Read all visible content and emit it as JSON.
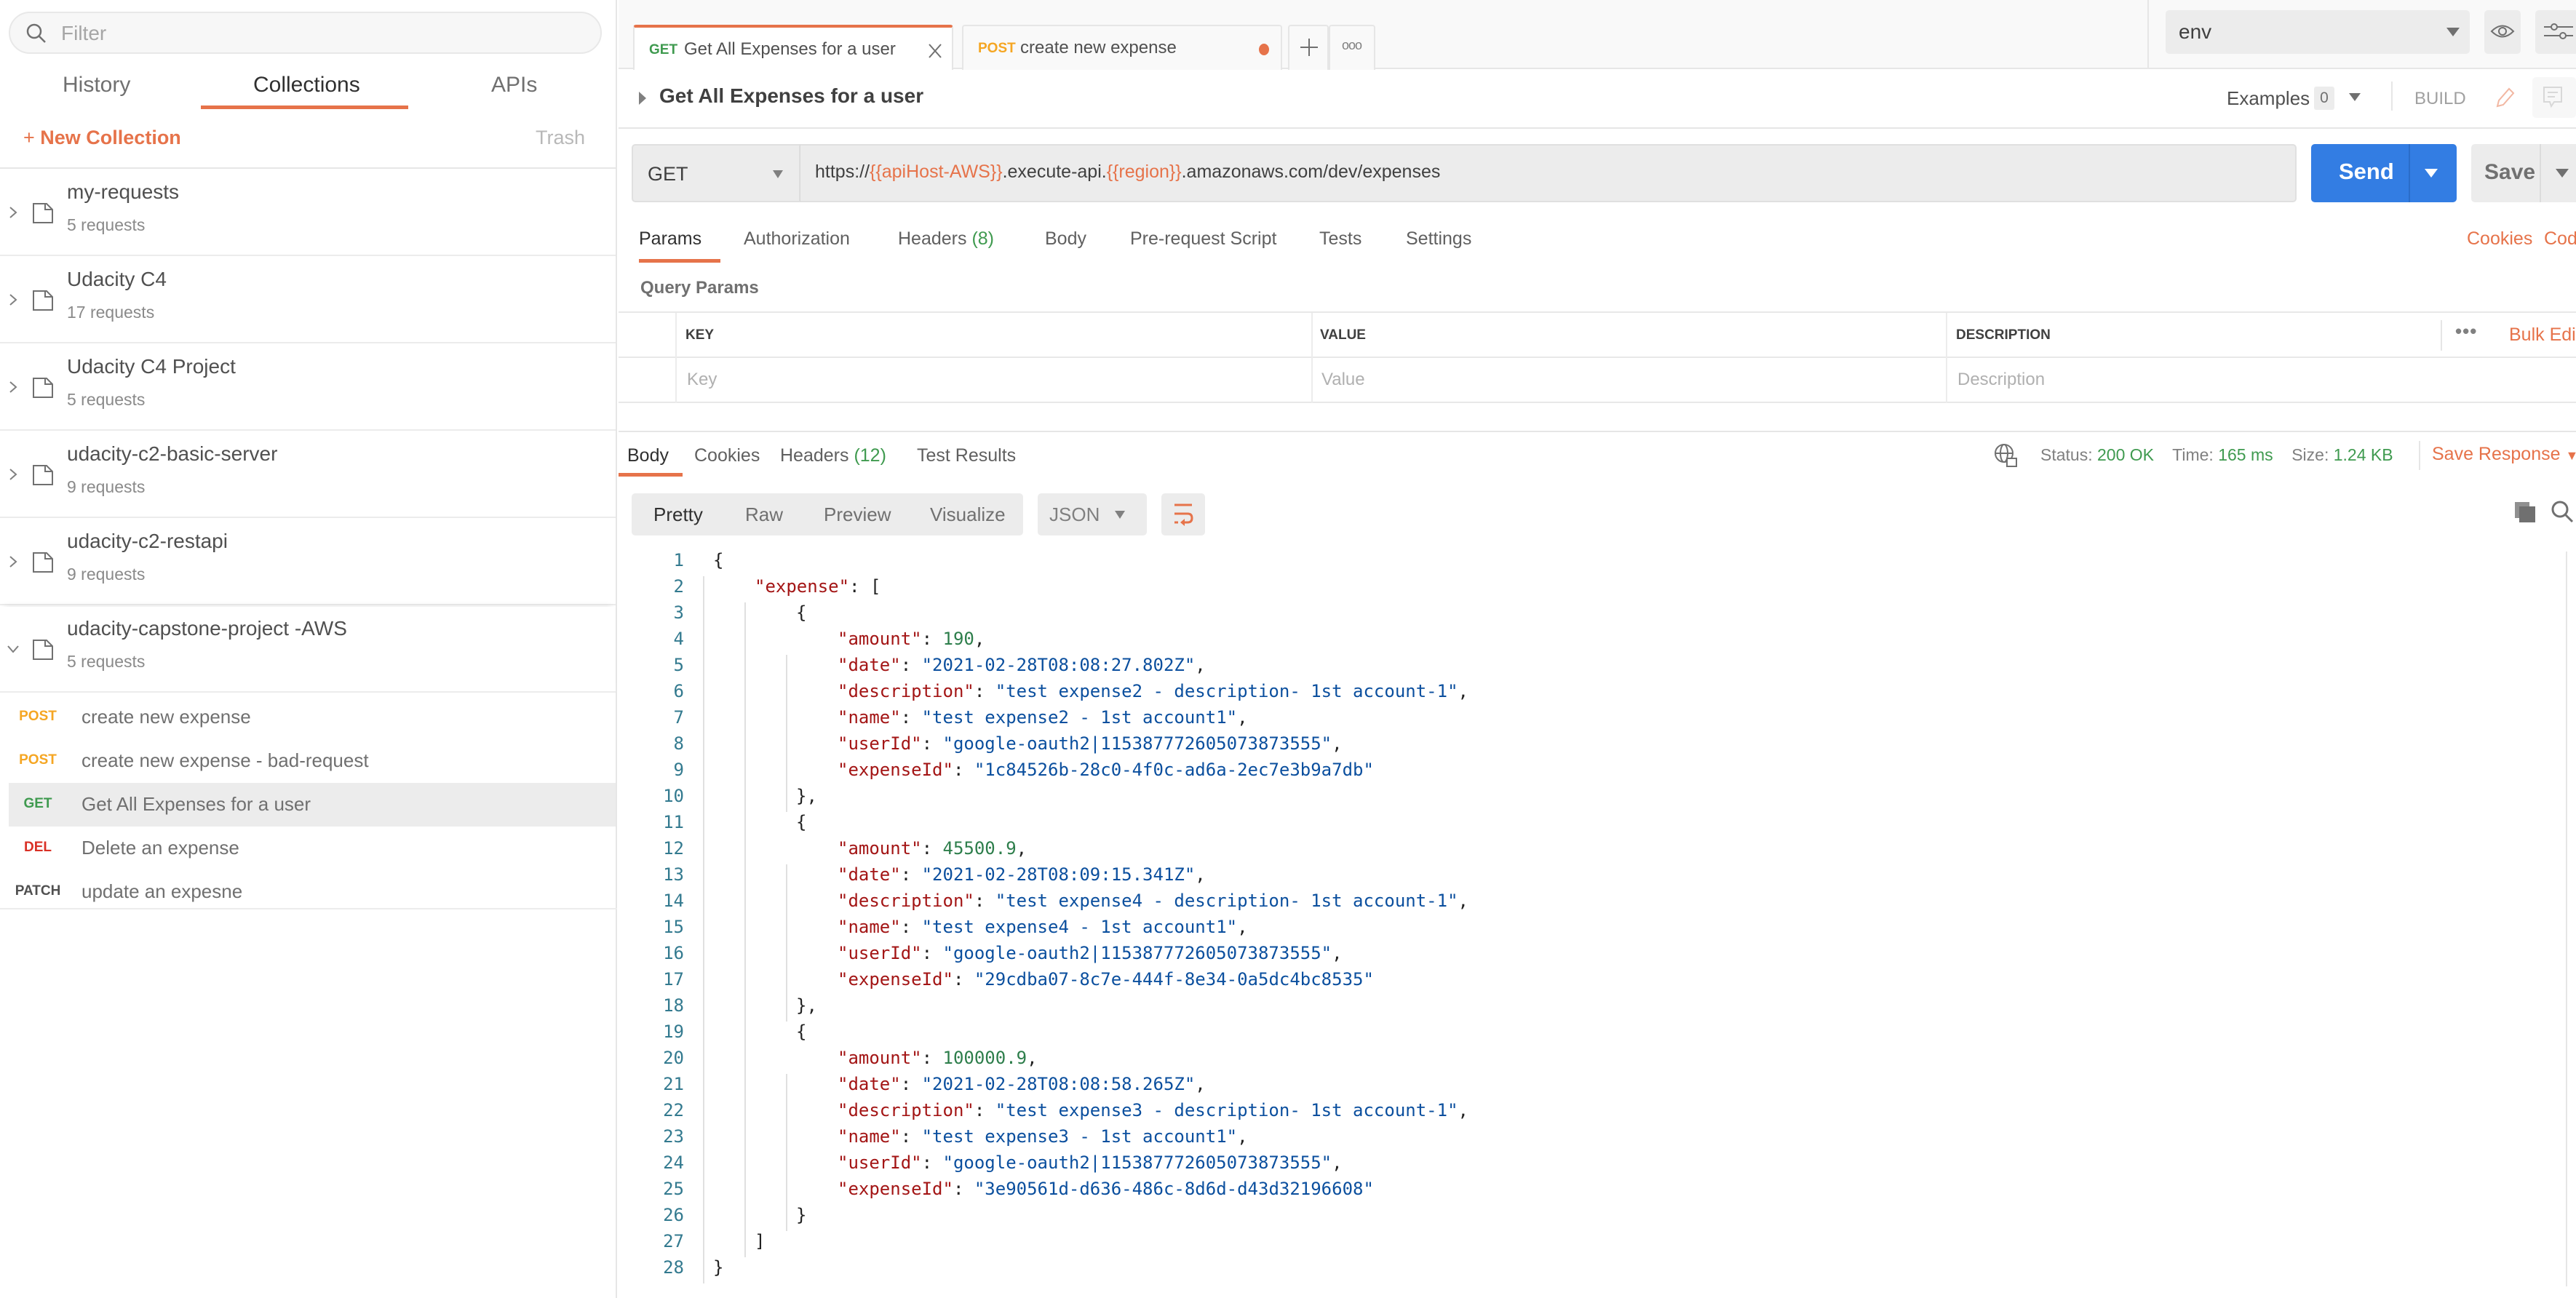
{
  "sidebar": {
    "filter_placeholder": "Filter",
    "tabs": [
      {
        "label": "History",
        "active": false
      },
      {
        "label": "Collections",
        "active": true
      },
      {
        "label": "APIs",
        "active": false
      }
    ],
    "new_collection_label": "New Collection",
    "trash_label": "Trash",
    "collections": [
      {
        "name": "my-requests",
        "count": "5 requests",
        "expanded": false
      },
      {
        "name": "Udacity C4",
        "count": "17 requests",
        "expanded": false
      },
      {
        "name": "Udacity C4 Project",
        "count": "5 requests",
        "expanded": false
      },
      {
        "name": "udacity-c2-basic-server",
        "count": "9 requests",
        "expanded": false
      },
      {
        "name": "udacity-c2-restapi",
        "count": "9 requests",
        "expanded": false
      },
      {
        "name": "udacity-capstone-project -AWS",
        "count": "5 requests",
        "expanded": true
      }
    ],
    "requests": [
      {
        "method": "POST",
        "name": "create new expense",
        "selected": false
      },
      {
        "method": "POST",
        "name": "create new expense - bad-request",
        "selected": false
      },
      {
        "method": "GET",
        "name": "Get All Expenses for a user",
        "selected": true
      },
      {
        "method": "DEL",
        "name": "Delete an expense",
        "selected": false
      },
      {
        "method": "PATCH",
        "name": "update an expesne",
        "selected": false
      }
    ]
  },
  "colors": {
    "accent": "#e6734a",
    "get": "#3f9a4f",
    "post": "#f5a623",
    "del": "#d93025",
    "patch": "#505050",
    "send": "#337de3"
  },
  "tabs": [
    {
      "method": "GET",
      "title": "Get All Expenses for a user",
      "active": true,
      "close_icon": "close-icon"
    },
    {
      "method": "POST",
      "title": "create new expense",
      "active": false,
      "unsaved": true
    }
  ],
  "environment": {
    "selected": "env"
  },
  "request": {
    "title": "Get All Expenses for a user",
    "examples_label": "Examples",
    "examples_count": "0",
    "build_label": "BUILD",
    "method": "GET",
    "url_parts": [
      {
        "text": "https://",
        "var": false
      },
      {
        "text": "{{apiHost-AWS}}",
        "var": true
      },
      {
        "text": ".execute-api.",
        "var": false
      },
      {
        "text": "{{region}}",
        "var": true
      },
      {
        "text": ".amazonaws.com/dev/expenses",
        "var": false
      }
    ],
    "send_label": "Send",
    "save_label": "Save",
    "tabs": [
      {
        "label": "Params",
        "active": true
      },
      {
        "label": "Authorization"
      },
      {
        "label": "Headers",
        "count": "(8)"
      },
      {
        "label": "Body"
      },
      {
        "label": "Pre-request Script"
      },
      {
        "label": "Tests"
      },
      {
        "label": "Settings"
      }
    ],
    "cookies_label": "Cookies",
    "code_label": "Code",
    "query_params_title": "Query Params",
    "params_table": {
      "headers": [
        "KEY",
        "VALUE",
        "DESCRIPTION"
      ],
      "placeholders": [
        "Key",
        "Value",
        "Description"
      ],
      "bulk_edit_label": "Bulk Edit"
    }
  },
  "response": {
    "tabs": [
      {
        "label": "Body",
        "active": true
      },
      {
        "label": "Cookies"
      },
      {
        "label": "Headers",
        "count": "(12)"
      },
      {
        "label": "Test Results"
      }
    ],
    "status_label": "Status:",
    "status_value": "200 OK",
    "time_label": "Time:",
    "time_value": "165 ms",
    "size_label": "Size:",
    "size_value": "1.24 KB",
    "save_response_label": "Save Response",
    "view_modes": [
      "Pretty",
      "Raw",
      "Preview",
      "Visualize"
    ],
    "active_view": "Pretty",
    "format": "JSON",
    "body_lines": [
      {
        "indent": 0,
        "tokens": [
          [
            "p",
            "{"
          ]
        ]
      },
      {
        "indent": 1,
        "tokens": [
          [
            "k",
            "\"expense\""
          ],
          [
            "p",
            ": ["
          ]
        ]
      },
      {
        "indent": 2,
        "tokens": [
          [
            "p",
            "{"
          ]
        ]
      },
      {
        "indent": 3,
        "tokens": [
          [
            "k",
            "\"amount\""
          ],
          [
            "p",
            ": "
          ],
          [
            "n",
            "190"
          ],
          [
            "p",
            ","
          ]
        ]
      },
      {
        "indent": 3,
        "tokens": [
          [
            "k",
            "\"date\""
          ],
          [
            "p",
            ": "
          ],
          [
            "s",
            "\"2021-02-28T08:08:27.802Z\""
          ],
          [
            "p",
            ","
          ]
        ]
      },
      {
        "indent": 3,
        "tokens": [
          [
            "k",
            "\"description\""
          ],
          [
            "p",
            ": "
          ],
          [
            "s",
            "\"test expense2 - description- 1st account-1\""
          ],
          [
            "p",
            ","
          ]
        ]
      },
      {
        "indent": 3,
        "tokens": [
          [
            "k",
            "\"name\""
          ],
          [
            "p",
            ": "
          ],
          [
            "s",
            "\"test expense2 - 1st account1\""
          ],
          [
            "p",
            ","
          ]
        ]
      },
      {
        "indent": 3,
        "tokens": [
          [
            "k",
            "\"userId\""
          ],
          [
            "p",
            ": "
          ],
          [
            "s",
            "\"google-oauth2|115387772605073873555\""
          ],
          [
            "p",
            ","
          ]
        ]
      },
      {
        "indent": 3,
        "tokens": [
          [
            "k",
            "\"expenseId\""
          ],
          [
            "p",
            ": "
          ],
          [
            "s",
            "\"1c84526b-28c0-4f0c-ad6a-2ec7e3b9a7db\""
          ]
        ]
      },
      {
        "indent": 2,
        "tokens": [
          [
            "p",
            "},"
          ]
        ]
      },
      {
        "indent": 2,
        "tokens": [
          [
            "p",
            "{"
          ]
        ]
      },
      {
        "indent": 3,
        "tokens": [
          [
            "k",
            "\"amount\""
          ],
          [
            "p",
            ": "
          ],
          [
            "n",
            "45500.9"
          ],
          [
            "p",
            ","
          ]
        ]
      },
      {
        "indent": 3,
        "tokens": [
          [
            "k",
            "\"date\""
          ],
          [
            "p",
            ": "
          ],
          [
            "s",
            "\"2021-02-28T08:09:15.341Z\""
          ],
          [
            "p",
            ","
          ]
        ]
      },
      {
        "indent": 3,
        "tokens": [
          [
            "k",
            "\"description\""
          ],
          [
            "p",
            ": "
          ],
          [
            "s",
            "\"test expense4 - description- 1st account-1\""
          ],
          [
            "p",
            ","
          ]
        ]
      },
      {
        "indent": 3,
        "tokens": [
          [
            "k",
            "\"name\""
          ],
          [
            "p",
            ": "
          ],
          [
            "s",
            "\"test expense4 - 1st account1\""
          ],
          [
            "p",
            ","
          ]
        ]
      },
      {
        "indent": 3,
        "tokens": [
          [
            "k",
            "\"userId\""
          ],
          [
            "p",
            ": "
          ],
          [
            "s",
            "\"google-oauth2|115387772605073873555\""
          ],
          [
            "p",
            ","
          ]
        ]
      },
      {
        "indent": 3,
        "tokens": [
          [
            "k",
            "\"expenseId\""
          ],
          [
            "p",
            ": "
          ],
          [
            "s",
            "\"29cdba07-8c7e-444f-8e34-0a5dc4bc8535\""
          ]
        ]
      },
      {
        "indent": 2,
        "tokens": [
          [
            "p",
            "},"
          ]
        ]
      },
      {
        "indent": 2,
        "tokens": [
          [
            "p",
            "{"
          ]
        ]
      },
      {
        "indent": 3,
        "tokens": [
          [
            "k",
            "\"amount\""
          ],
          [
            "p",
            ": "
          ],
          [
            "n",
            "100000.9"
          ],
          [
            "p",
            ","
          ]
        ]
      },
      {
        "indent": 3,
        "tokens": [
          [
            "k",
            "\"date\""
          ],
          [
            "p",
            ": "
          ],
          [
            "s",
            "\"2021-02-28T08:08:58.265Z\""
          ],
          [
            "p",
            ","
          ]
        ]
      },
      {
        "indent": 3,
        "tokens": [
          [
            "k",
            "\"description\""
          ],
          [
            "p",
            ": "
          ],
          [
            "s",
            "\"test expense3 - description- 1st account-1\""
          ],
          [
            "p",
            ","
          ]
        ]
      },
      {
        "indent": 3,
        "tokens": [
          [
            "k",
            "\"name\""
          ],
          [
            "p",
            ": "
          ],
          [
            "s",
            "\"test expense3 - 1st account1\""
          ],
          [
            "p",
            ","
          ]
        ]
      },
      {
        "indent": 3,
        "tokens": [
          [
            "k",
            "\"userId\""
          ],
          [
            "p",
            ": "
          ],
          [
            "s",
            "\"google-oauth2|115387772605073873555\""
          ],
          [
            "p",
            ","
          ]
        ]
      },
      {
        "indent": 3,
        "tokens": [
          [
            "k",
            "\"expenseId\""
          ],
          [
            "p",
            ": "
          ],
          [
            "s",
            "\"3e90561d-d636-486c-8d6d-d43d32196608\""
          ]
        ]
      },
      {
        "indent": 2,
        "tokens": [
          [
            "p",
            "}"
          ]
        ]
      },
      {
        "indent": 1,
        "tokens": [
          [
            "p",
            "]"
          ]
        ]
      },
      {
        "indent": 0,
        "tokens": [
          [
            "p",
            "}"
          ]
        ]
      }
    ]
  }
}
